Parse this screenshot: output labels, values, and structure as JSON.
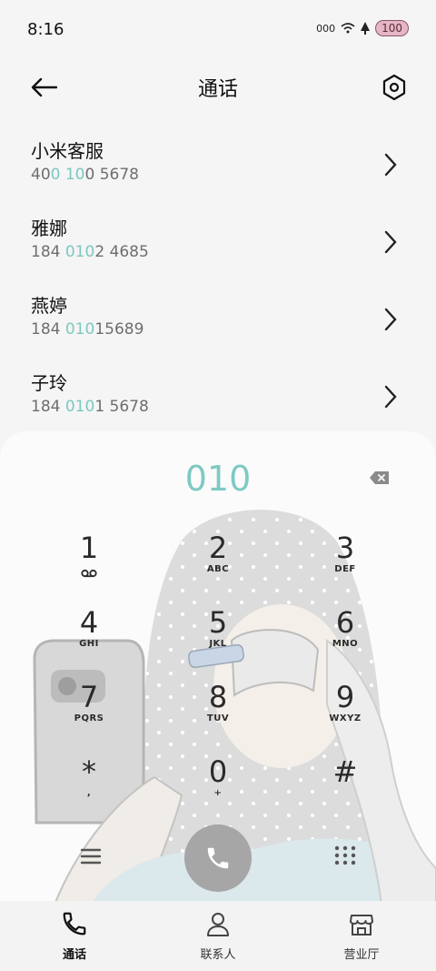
{
  "status": {
    "time": "8:16",
    "battery": "100",
    "signal": "000"
  },
  "header": {
    "title": "通话"
  },
  "contacts": [
    {
      "name": "小米客服",
      "num_a": "40",
      "num_b": "0 10",
      "num_c": "0 5678"
    },
    {
      "name": "雅娜",
      "num_a": "184 ",
      "num_b": "010",
      "num_c": "2 4685"
    },
    {
      "name": "燕婷",
      "num_a": "184 ",
      "num_b": "010",
      "num_c": "15689"
    },
    {
      "name": "子玲",
      "num_a": "184 ",
      "num_b": "010",
      "num_c": "1 5678"
    }
  ],
  "dialpad": {
    "digits": "010",
    "keys": [
      {
        "num": "1",
        "sub": ""
      },
      {
        "num": "2",
        "sub": "ABC"
      },
      {
        "num": "3",
        "sub": "DEF"
      },
      {
        "num": "4",
        "sub": "GHI"
      },
      {
        "num": "5",
        "sub": "JKL"
      },
      {
        "num": "6",
        "sub": "MNO"
      },
      {
        "num": "7",
        "sub": "PQRS"
      },
      {
        "num": "8",
        "sub": "TUV"
      },
      {
        "num": "9",
        "sub": "WXYZ"
      },
      {
        "num": "*",
        "sub": ","
      },
      {
        "num": "0",
        "sub": "+"
      },
      {
        "num": "#",
        "sub": ""
      }
    ]
  },
  "nav": {
    "calls": "通话",
    "contacts": "联系人",
    "store": "营业厅"
  },
  "colors": {
    "accent": "#7ecac2",
    "call_button": "#a6a6a6"
  }
}
